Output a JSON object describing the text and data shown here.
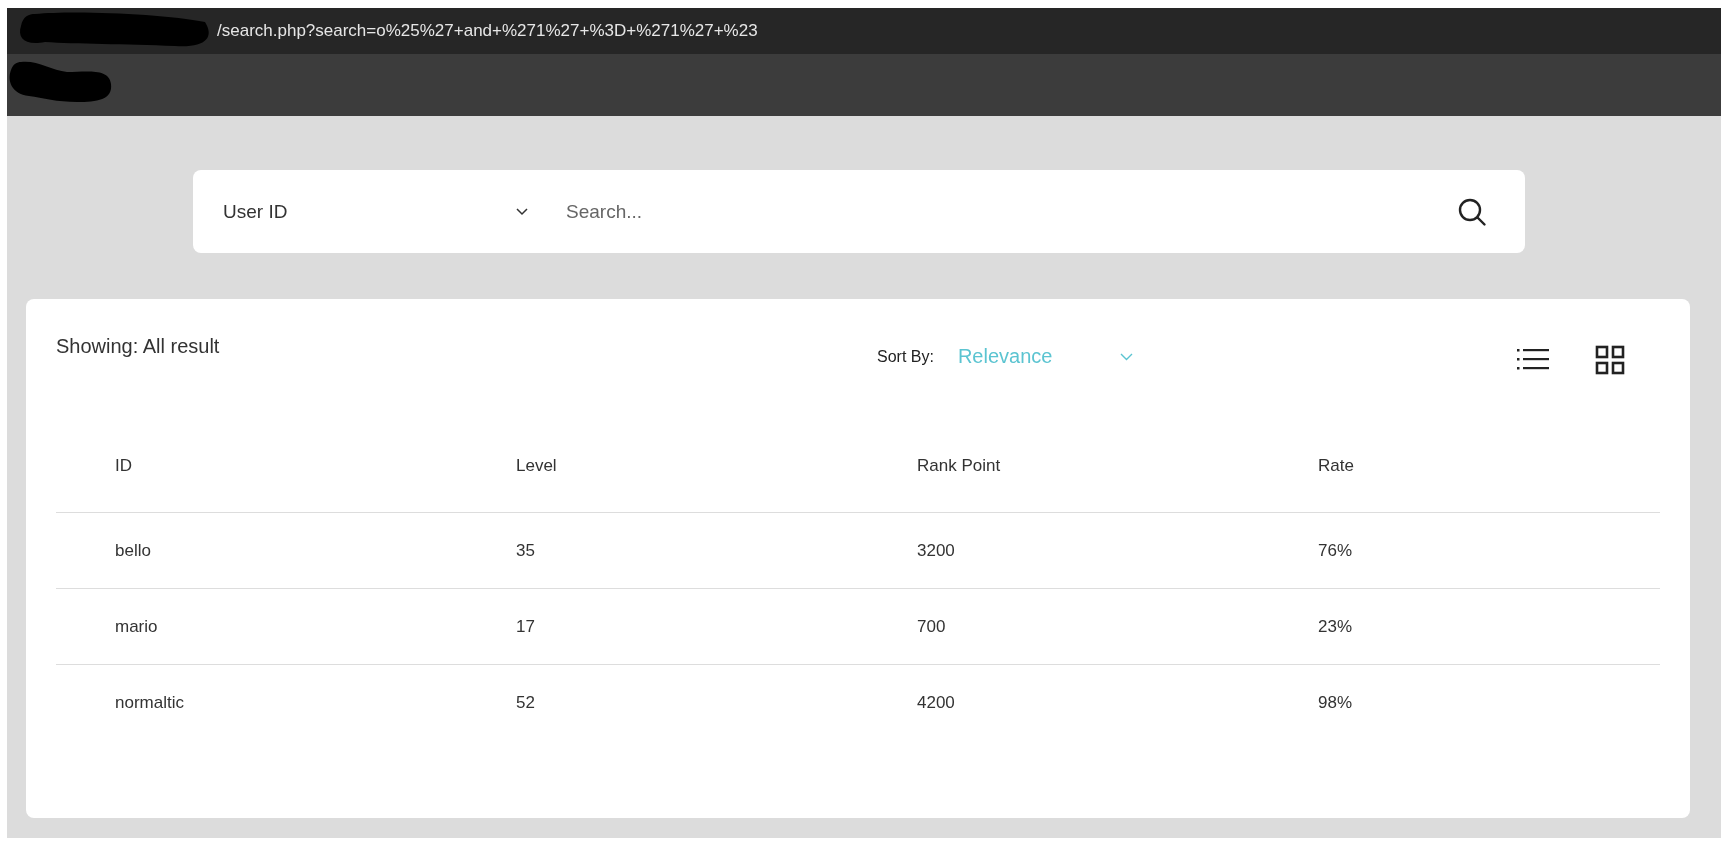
{
  "address_bar": {
    "url": "/search.php?search=o%25%27+and+%271%27+%3D+%271%27+%23"
  },
  "search": {
    "filter": "User ID",
    "placeholder": "Search..."
  },
  "results": {
    "showing": "Showing: All result",
    "sort_label": "Sort By:",
    "sort_value": "Relevance",
    "table": {
      "columns": [
        "ID",
        "Level",
        "Rank Point",
        "Rate"
      ],
      "rows": [
        [
          "bello",
          "35",
          "3200",
          "76%"
        ],
        [
          "mario",
          "17",
          "700",
          "23%"
        ],
        [
          "normaltic",
          "52",
          "4200",
          "98%"
        ]
      ]
    }
  }
}
